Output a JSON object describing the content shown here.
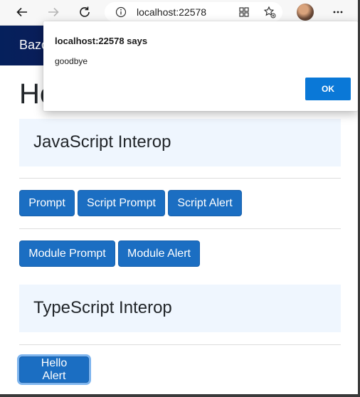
{
  "browser": {
    "address": "localhost:22578"
  },
  "page": {
    "brand": "Bazor",
    "heading": "Hello",
    "sections": {
      "js_title": "JavaScript Interop",
      "ts_title": "TypeScript Interop"
    },
    "buttons": {
      "prompt": "Prompt",
      "script_prompt": "Script Prompt",
      "script_alert": "Script Alert",
      "module_prompt": "Module Prompt",
      "module_alert": "Module Alert",
      "hello_alert": "Hello Alert"
    }
  },
  "dialog": {
    "title": "localhost:22578 says",
    "message": "goodbye",
    "ok_label": "OK"
  },
  "colors": {
    "primary": "#1b6ec2",
    "section_bg": "#eff6fe",
    "dialog_ok": "#0a78d7"
  }
}
